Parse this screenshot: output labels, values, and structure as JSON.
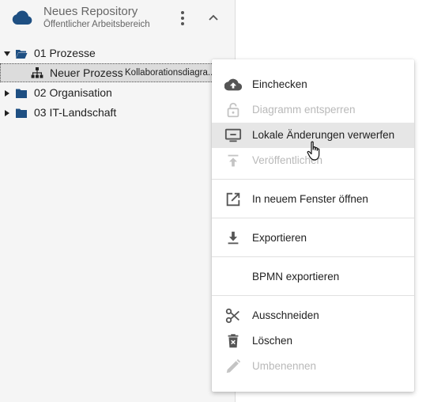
{
  "repository": {
    "title": "Neues Repository",
    "subtitle": "Öffentlicher Arbeitsbereich",
    "icon": "cloud-icon",
    "accent": "#1e4f82"
  },
  "tree": {
    "items": [
      {
        "label": "01 Prozesse",
        "expanded": true,
        "icon": "folder-open-icon"
      },
      {
        "label": "Neuer Prozess",
        "type_label": "Kollaborationsdiagra...",
        "selected": true,
        "icon": "sitemap-icon"
      },
      {
        "label": "02 Organisation",
        "expanded": false,
        "icon": "folder-icon"
      },
      {
        "label": "03 IT-Landschaft",
        "expanded": false,
        "icon": "folder-icon"
      }
    ]
  },
  "context_menu": {
    "items": [
      {
        "label": "Einchecken",
        "icon": "cloud-upload-icon",
        "enabled": true
      },
      {
        "label": "Diagramm entsperren",
        "icon": "lock-open-icon",
        "enabled": false
      },
      {
        "label": "Lokale Änderungen verwerfen",
        "icon": "monitor-minus-icon",
        "enabled": true,
        "hovered": true
      },
      {
        "label": "Veröffentlichen",
        "icon": "publish-icon",
        "enabled": false
      },
      {
        "label": "In neuem Fenster öffnen",
        "icon": "open-in-new-icon",
        "enabled": true
      },
      {
        "label": "Exportieren",
        "icon": "download-icon",
        "enabled": true
      },
      {
        "label": "BPMN exportieren",
        "icon": "",
        "enabled": true
      },
      {
        "label": "Ausschneiden",
        "icon": "scissors-icon",
        "enabled": true
      },
      {
        "label": "Löschen",
        "icon": "trash-icon",
        "enabled": true
      },
      {
        "label": "Umbenennen",
        "icon": "pencil-icon",
        "enabled": false
      }
    ]
  },
  "colors": {
    "icon_dark": "#555555",
    "icon_disabled": "#c4c4c4",
    "folder": "#1e4f82"
  }
}
